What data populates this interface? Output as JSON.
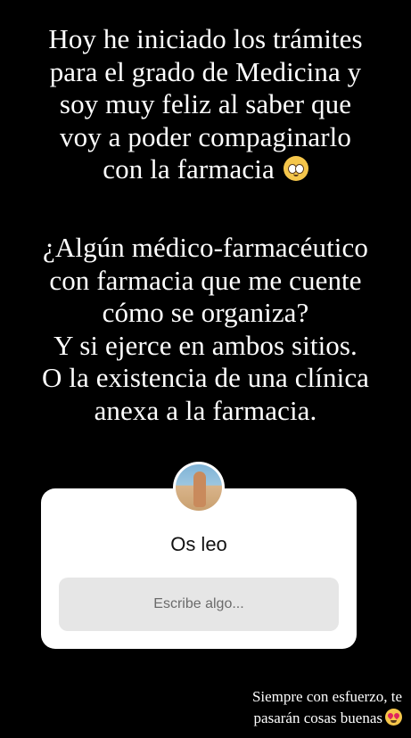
{
  "story": {
    "paragraph1": [
      "Hoy he iniciado los trámites",
      "para el grado de Medicina y",
      "soy muy feliz al saber que",
      "voy a poder compaginarlo",
      "con la farmacia"
    ],
    "paragraph1_emoji": "pleading-face-emoji",
    "paragraph2": [
      "¿Algún médico-farmacéutico",
      "con farmacia que me cuente",
      "cómo se organiza?",
      "Y si ejerce en ambos sitios.",
      "O la existencia de una clínica",
      "anexa a la farmacia."
    ]
  },
  "question_sticker": {
    "title": "Os leo",
    "input_placeholder": "Escribe algo..."
  },
  "caption": {
    "lines": [
      "Siempre con esfuerzo, te",
      "pasarán cosas buenas"
    ],
    "emoji": "heart-eyes-emoji"
  },
  "colors": {
    "background": "#000000",
    "text": "#ffffff",
    "card": "#ffffff",
    "input_bg": "#e6e6e6"
  }
}
